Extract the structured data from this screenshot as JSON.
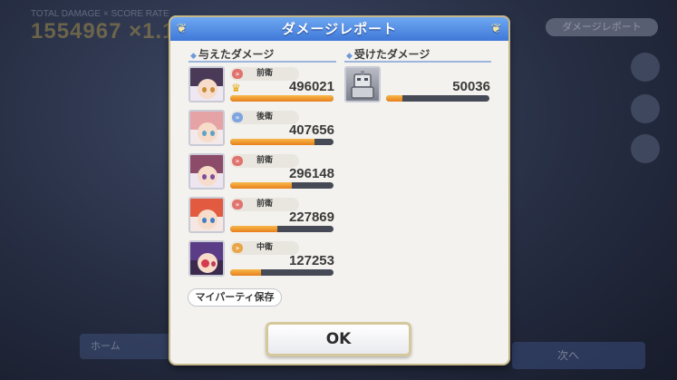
{
  "background": {
    "score_caption": "TOTAL DAMAGE × SCORE RATE",
    "score_value": "1554967 ×1.1",
    "top_right_pill": "ダメージレポート",
    "left_button": "ホーム",
    "right_button": "次へ"
  },
  "dialog": {
    "title": "ダメージレポート",
    "dealt_header": "与えたダメージ",
    "received_header": "受けたダメージ",
    "party_button": "マイパーティ保存",
    "ok_button": "OK"
  },
  "dealt": [
    {
      "position": "前衛",
      "value": "496021",
      "ratio": 1.0,
      "mvp": true
    },
    {
      "position": "後衛",
      "value": "407656",
      "ratio": 0.82,
      "mvp": false
    },
    {
      "position": "前衛",
      "value": "296148",
      "ratio": 0.6,
      "mvp": false
    },
    {
      "position": "前衛",
      "value": "227869",
      "ratio": 0.46,
      "mvp": false
    },
    {
      "position": "中衛",
      "value": "127253",
      "ratio": 0.3,
      "mvp": false
    }
  ],
  "received": [
    {
      "value": "50036",
      "ratio": 0.16
    }
  ],
  "colors": {
    "header_blue": "#4f86e0",
    "bar_orange": "#f2a033",
    "bar_track": "#454a56",
    "front_icon": "#e0736d",
    "back_icon": "#7fa4e0",
    "middle_icon": "#e9a548"
  }
}
